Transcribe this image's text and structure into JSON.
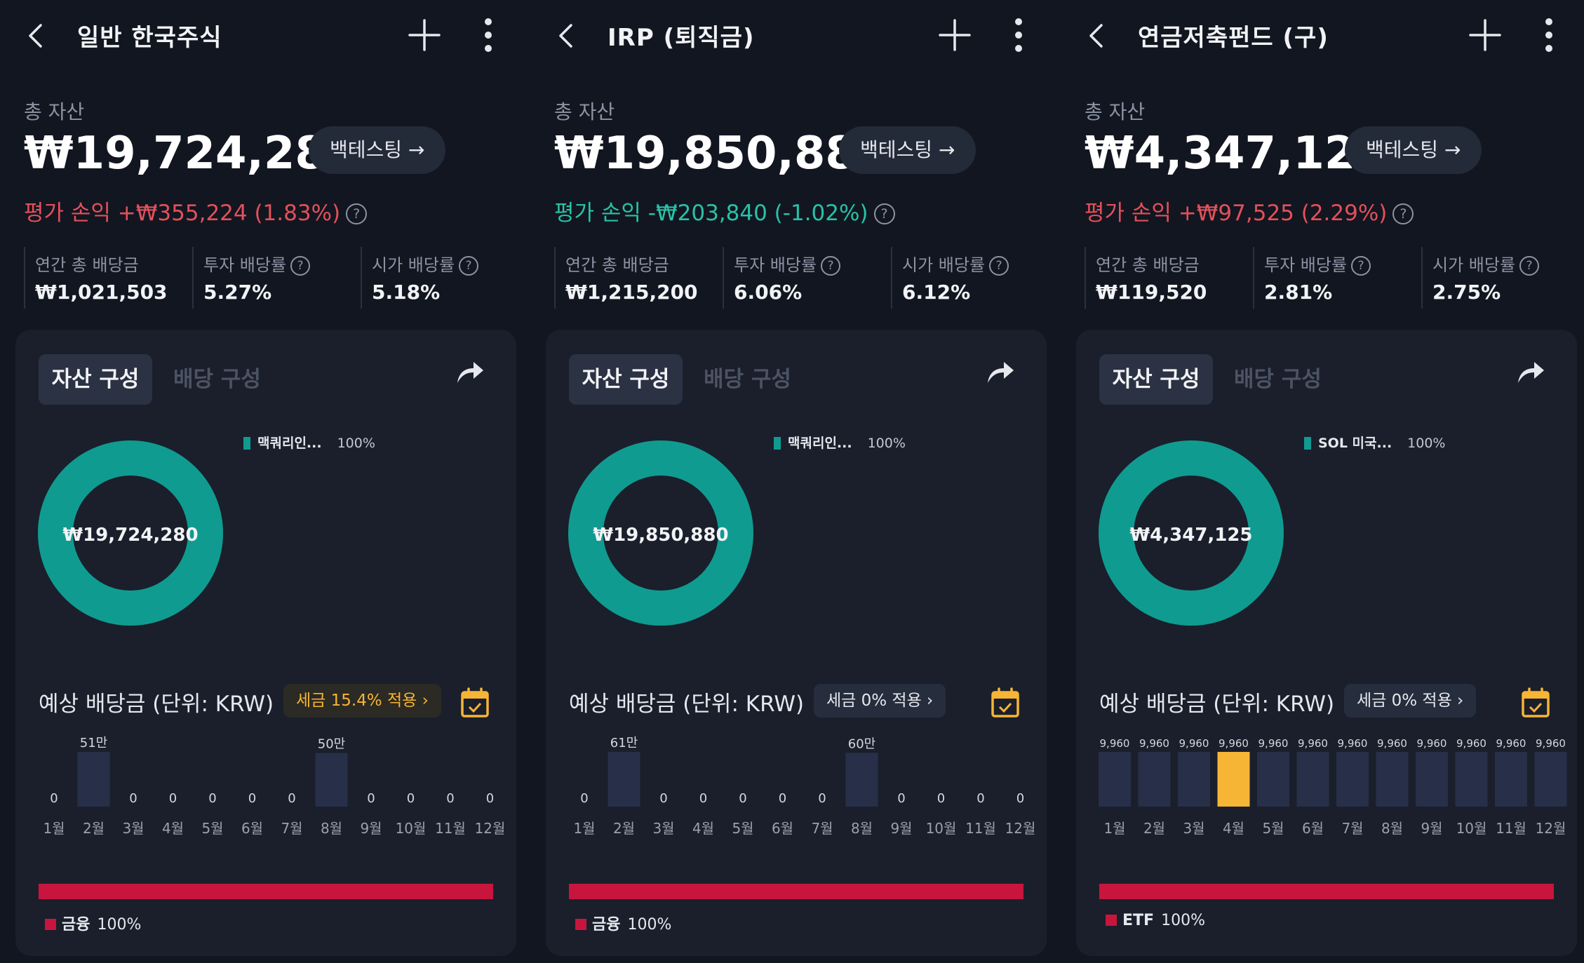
{
  "colors": {
    "profit": "#e3505b",
    "loss": "#28c2a8",
    "donut": "#109b90",
    "sector": "#c8153d",
    "highlight": "#f6b535",
    "bar": "#273048"
  },
  "common": {
    "total_label": "총 자산",
    "backtest_label": "백테스팅 →",
    "help_mark": "?",
    "stat_labels": [
      "연간 총 배당금",
      "투자 배당률",
      "시가 배당률"
    ],
    "tab_asset": "자산 구성",
    "tab_dividend": "배당 구성",
    "dividend_title": "예상 배당금 (단위: KRW)",
    "month_labels": [
      "1월",
      "2월",
      "3월",
      "4월",
      "5월",
      "6월",
      "7월",
      "8월",
      "9월",
      "10월",
      "11월",
      "12월"
    ]
  },
  "panels": [
    {
      "title": "일반 한국주식",
      "total": "₩19,724,280",
      "pnl": "평가 손익 +₩355,224 (1.83%)",
      "pnl_positive": true,
      "stats": [
        "₩1,021,503",
        "5.27%",
        "5.18%"
      ],
      "donut_center": "₩19,724,280",
      "legend_name": "맥쿼리인...",
      "legend_pct": "100%",
      "tax_chip": "세금 15.4% 적용 ›",
      "tax_warn": true,
      "sector_name": "금융",
      "sector_pct": "100%",
      "chart_data": {
        "type": "bar",
        "categories": [
          "1월",
          "2월",
          "3월",
          "4월",
          "5월",
          "6월",
          "7월",
          "8월",
          "9월",
          "10월",
          "11월",
          "12월"
        ],
        "values": [
          0,
          510000,
          0,
          0,
          0,
          0,
          0,
          500000,
          0,
          0,
          0,
          0
        ],
        "value_labels": [
          "0",
          "51만",
          "0",
          "0",
          "0",
          "0",
          "0",
          "50만",
          "0",
          "0",
          "0",
          "0"
        ],
        "highlight_index": -1,
        "ylim": [
          0,
          510000
        ]
      }
    },
    {
      "title": "IRP (퇴직금)",
      "total": "₩19,850,880",
      "pnl": "평가 손익 -₩203,840 (-1.02%)",
      "pnl_positive": false,
      "stats": [
        "₩1,215,200",
        "6.06%",
        "6.12%"
      ],
      "donut_center": "₩19,850,880",
      "legend_name": "맥쿼리인...",
      "legend_pct": "100%",
      "tax_chip": "세금 0% 적용 ›",
      "tax_warn": false,
      "sector_name": "금융",
      "sector_pct": "100%",
      "chart_data": {
        "type": "bar",
        "categories": [
          "1월",
          "2월",
          "3월",
          "4월",
          "5월",
          "6월",
          "7월",
          "8월",
          "9월",
          "10월",
          "11월",
          "12월"
        ],
        "values": [
          0,
          610000,
          0,
          0,
          0,
          0,
          0,
          600000,
          0,
          0,
          0,
          0
        ],
        "value_labels": [
          "0",
          "61만",
          "0",
          "0",
          "0",
          "0",
          "0",
          "60만",
          "0",
          "0",
          "0",
          "0"
        ],
        "highlight_index": -1,
        "ylim": [
          0,
          610000
        ]
      }
    },
    {
      "title": "연금저축펀드 (구)",
      "total": "₩4,347,125",
      "pnl": "평가 손익 +₩97,525 (2.29%)",
      "pnl_positive": true,
      "stats": [
        "₩119,520",
        "2.81%",
        "2.75%"
      ],
      "donut_center": "₩4,347,125",
      "legend_name": "SOL 미국...",
      "legend_pct": "100%",
      "tax_chip": "세금 0% 적용 ›",
      "tax_warn": false,
      "sector_name": "ETF",
      "sector_pct": "100%",
      "chart_data": {
        "type": "bar",
        "categories": [
          "1월",
          "2월",
          "3월",
          "4월",
          "5월",
          "6월",
          "7월",
          "8월",
          "9월",
          "10월",
          "11월",
          "12월"
        ],
        "values": [
          9960,
          9960,
          9960,
          9960,
          9960,
          9960,
          9960,
          9960,
          9960,
          9960,
          9960,
          9960
        ],
        "value_labels": [
          "9,960",
          "9,960",
          "9,960",
          "9,960",
          "9,960",
          "9,960",
          "9,960",
          "9,960",
          "9,960",
          "9,960",
          "9,960",
          "9,960"
        ],
        "highlight_index": 3,
        "ylim": [
          0,
          9960
        ]
      }
    }
  ]
}
